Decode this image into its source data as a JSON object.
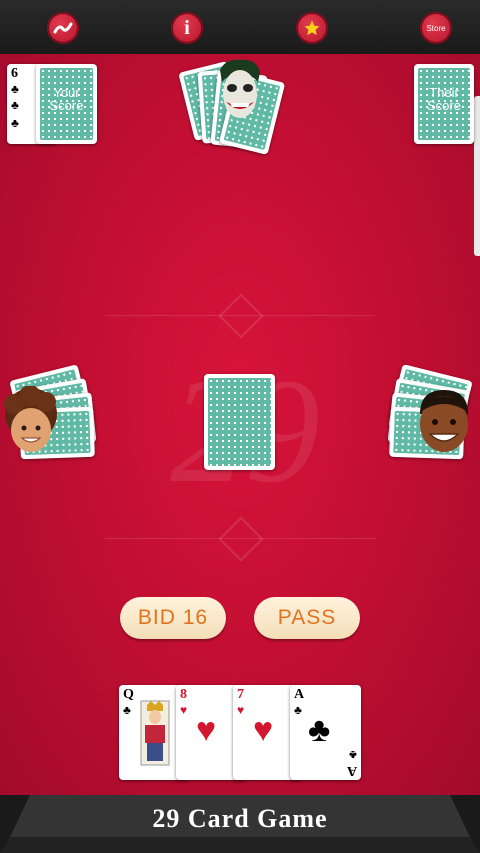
{
  "toolbar": {
    "back_icon": "swoosh-icon",
    "info_label": "i",
    "favorite_icon": "star-icon",
    "store_label": "Store"
  },
  "scores": {
    "your_card_rank": "6",
    "your_card_suit": "♣",
    "your_label": "Your Score",
    "their_label": "Their Score"
  },
  "table": {
    "watermark": "29"
  },
  "actions": {
    "bid_label": "BID 16",
    "pass_label": "PASS"
  },
  "hand": [
    {
      "rank": "Q",
      "suit": "♣",
      "color": "#000000"
    },
    {
      "rank": "8",
      "suit": "♥",
      "color": "#d4152f"
    },
    {
      "rank": "7",
      "suit": "♥",
      "color": "#d4152f"
    },
    {
      "rank": "A",
      "suit": "♣",
      "color": "#000000"
    }
  ],
  "footer": {
    "title": "29 Card Game"
  },
  "colors": {
    "felt": "#c30f33",
    "button": "#c8102e",
    "card_back": "#5fb9a5",
    "pill_text": "#e2731e"
  }
}
